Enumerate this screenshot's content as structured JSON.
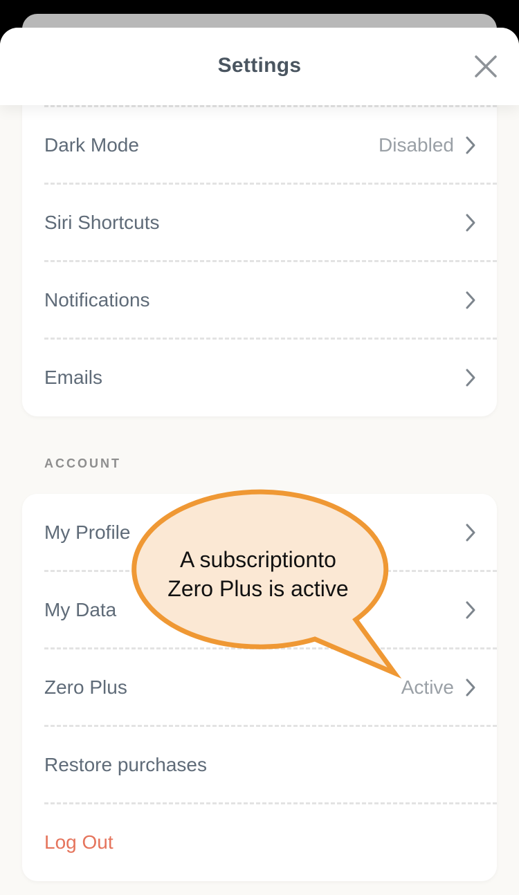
{
  "header": {
    "title": "Settings"
  },
  "preferences": {
    "items": [
      {
        "label": "Dark Mode",
        "value": "Disabled"
      },
      {
        "label": "Siri Shortcuts",
        "value": ""
      },
      {
        "label": "Notifications",
        "value": ""
      },
      {
        "label": "Emails",
        "value": ""
      }
    ]
  },
  "account": {
    "section_label": "ACCOUNT",
    "items": [
      {
        "label": "My Profile",
        "value": ""
      },
      {
        "label": "My Data",
        "value": ""
      },
      {
        "label": "Zero Plus",
        "value": "Active"
      },
      {
        "label": "Restore purchases",
        "value": ""
      },
      {
        "label": "Log Out",
        "value": ""
      }
    ]
  },
  "callout": {
    "line1": "A subscriptionto",
    "line2": "Zero Plus is active"
  },
  "icons": {
    "close": "close-icon",
    "chevron": "chevron-right-icon"
  },
  "colors": {
    "danger": "#e5745c",
    "callout_fill": "#fbe8d4",
    "callout_stroke": "#ef9834"
  }
}
